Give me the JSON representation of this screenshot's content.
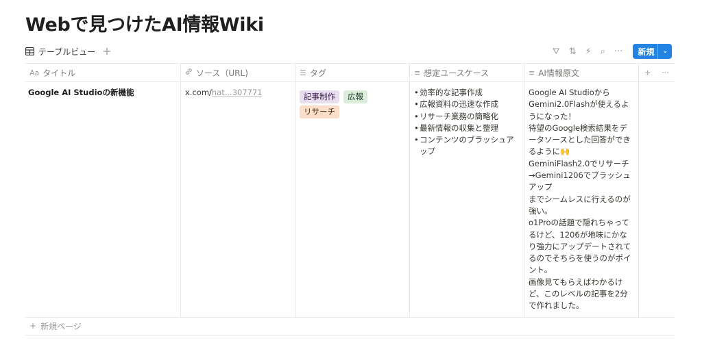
{
  "page": {
    "title": "Webで見つけたAI情報Wiki"
  },
  "view": {
    "tab_label": "テーブルビュー",
    "add_symbol": "+",
    "tools": {
      "filter": "⛛",
      "sort": "⇅",
      "automation": "⚡",
      "search": "⌕",
      "more": "···"
    },
    "new_label": "新規",
    "new_chevron": "⌄"
  },
  "columns": [
    {
      "label": "タイトル",
      "icon": "Aa"
    },
    {
      "label": "ソース（URL)",
      "icon": "🔗"
    },
    {
      "label": "タグ",
      "icon": "☰"
    },
    {
      "label": "想定ユースケース",
      "icon": "≡"
    },
    {
      "label": "AI情報原文",
      "icon": "≡"
    }
  ],
  "header_extra": {
    "add": "+",
    "more": "···"
  },
  "row": {
    "title": "Google AI Studioの新機能",
    "source_host": "x.com/",
    "source_rest": "hat...307771",
    "tags": [
      {
        "label": "記事制作",
        "color": "#e8deee"
      },
      {
        "label": "広報",
        "color": "#dbeddb"
      },
      {
        "label": "リサーチ",
        "color": "#fadec9"
      }
    ],
    "use_cases": [
      "効率的な記事作成",
      "広報資料の迅速な作成",
      "リサーチ業務の簡略化",
      "最新情報の収集と整理",
      "コンテンツのブラッシュアップ"
    ],
    "original": "Google AI Studioから\nGemini2.0Flashが使えるようになった！\n待望のGoogle検索結果をデータソースとした回答ができるように🙌\nGeminiFlash2.0でリサーチ→Gemini1206でブラッシュアップ\nまでシームレスに行えるのが強い。\no1Proの話題で隠れちゃってるけど、1206が地味にかなり強力にアップデートされてるのでそちらを使うのがポイント。\n画像見てもらえばわかるけど、このレベルの記事を2分で作れました。"
  },
  "new_page_label": "新規ページ",
  "new_page_symbol": "+"
}
